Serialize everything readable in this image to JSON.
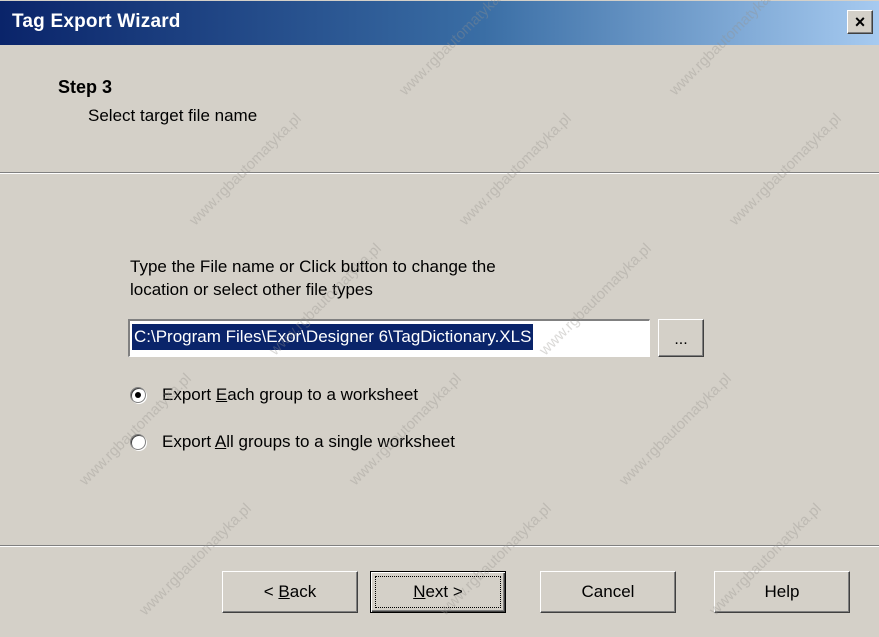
{
  "window": {
    "title": "Tag Export Wizard",
    "close_label": "×"
  },
  "header": {
    "step_title": "Step 3",
    "step_subtitle": "Select target file name"
  },
  "body": {
    "instruction_line1": "Type the File name or Click button to change the",
    "instruction_line2": "location or select other file types",
    "file_path": "C:\\Program Files\\Exor\\Designer 6\\TagDictionary.XLS",
    "browse_label": "..."
  },
  "options": {
    "each_group": {
      "prefix": "Export ",
      "accel": "E",
      "suffix": "ach group to a worksheet",
      "checked": true
    },
    "all_groups": {
      "prefix": "Export ",
      "accel": "A",
      "suffix": "ll groups to a single worksheet",
      "checked": false
    }
  },
  "buttons": {
    "back_prefix": "< ",
    "back_accel": "B",
    "back_suffix": "ack",
    "next_accel": "N",
    "next_suffix": "ext >",
    "cancel": "Cancel",
    "help": "Help"
  },
  "watermark_text": "www.rgbautomatyka.pl"
}
